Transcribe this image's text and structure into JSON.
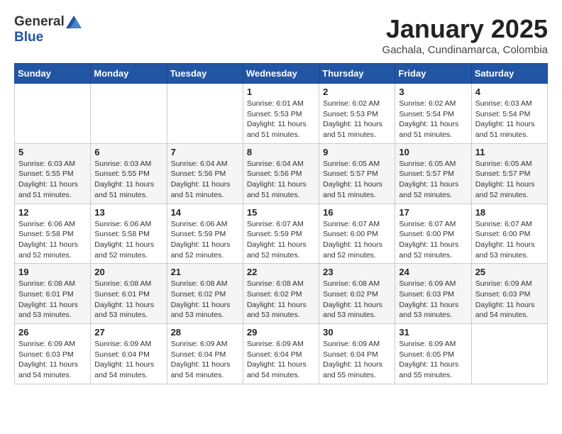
{
  "header": {
    "logo_line1": "General",
    "logo_line2": "Blue",
    "month": "January 2025",
    "location": "Gachala, Cundinamarca, Colombia"
  },
  "weekdays": [
    "Sunday",
    "Monday",
    "Tuesday",
    "Wednesday",
    "Thursday",
    "Friday",
    "Saturday"
  ],
  "weeks": [
    [
      {
        "day": "",
        "info": ""
      },
      {
        "day": "",
        "info": ""
      },
      {
        "day": "",
        "info": ""
      },
      {
        "day": "1",
        "info": "Sunrise: 6:01 AM\nSunset: 5:53 PM\nDaylight: 11 hours\nand 51 minutes."
      },
      {
        "day": "2",
        "info": "Sunrise: 6:02 AM\nSunset: 5:53 PM\nDaylight: 11 hours\nand 51 minutes."
      },
      {
        "day": "3",
        "info": "Sunrise: 6:02 AM\nSunset: 5:54 PM\nDaylight: 11 hours\nand 51 minutes."
      },
      {
        "day": "4",
        "info": "Sunrise: 6:03 AM\nSunset: 5:54 PM\nDaylight: 11 hours\nand 51 minutes."
      }
    ],
    [
      {
        "day": "5",
        "info": "Sunrise: 6:03 AM\nSunset: 5:55 PM\nDaylight: 11 hours\nand 51 minutes."
      },
      {
        "day": "6",
        "info": "Sunrise: 6:03 AM\nSunset: 5:55 PM\nDaylight: 11 hours\nand 51 minutes."
      },
      {
        "day": "7",
        "info": "Sunrise: 6:04 AM\nSunset: 5:56 PM\nDaylight: 11 hours\nand 51 minutes."
      },
      {
        "day": "8",
        "info": "Sunrise: 6:04 AM\nSunset: 5:56 PM\nDaylight: 11 hours\nand 51 minutes."
      },
      {
        "day": "9",
        "info": "Sunrise: 6:05 AM\nSunset: 5:57 PM\nDaylight: 11 hours\nand 51 minutes."
      },
      {
        "day": "10",
        "info": "Sunrise: 6:05 AM\nSunset: 5:57 PM\nDaylight: 11 hours\nand 52 minutes."
      },
      {
        "day": "11",
        "info": "Sunrise: 6:05 AM\nSunset: 5:57 PM\nDaylight: 11 hours\nand 52 minutes."
      }
    ],
    [
      {
        "day": "12",
        "info": "Sunrise: 6:06 AM\nSunset: 5:58 PM\nDaylight: 11 hours\nand 52 minutes."
      },
      {
        "day": "13",
        "info": "Sunrise: 6:06 AM\nSunset: 5:58 PM\nDaylight: 11 hours\nand 52 minutes."
      },
      {
        "day": "14",
        "info": "Sunrise: 6:06 AM\nSunset: 5:59 PM\nDaylight: 11 hours\nand 52 minutes."
      },
      {
        "day": "15",
        "info": "Sunrise: 6:07 AM\nSunset: 5:59 PM\nDaylight: 11 hours\nand 52 minutes."
      },
      {
        "day": "16",
        "info": "Sunrise: 6:07 AM\nSunset: 6:00 PM\nDaylight: 11 hours\nand 52 minutes."
      },
      {
        "day": "17",
        "info": "Sunrise: 6:07 AM\nSunset: 6:00 PM\nDaylight: 11 hours\nand 52 minutes."
      },
      {
        "day": "18",
        "info": "Sunrise: 6:07 AM\nSunset: 6:00 PM\nDaylight: 11 hours\nand 53 minutes."
      }
    ],
    [
      {
        "day": "19",
        "info": "Sunrise: 6:08 AM\nSunset: 6:01 PM\nDaylight: 11 hours\nand 53 minutes."
      },
      {
        "day": "20",
        "info": "Sunrise: 6:08 AM\nSunset: 6:01 PM\nDaylight: 11 hours\nand 53 minutes."
      },
      {
        "day": "21",
        "info": "Sunrise: 6:08 AM\nSunset: 6:02 PM\nDaylight: 11 hours\nand 53 minutes."
      },
      {
        "day": "22",
        "info": "Sunrise: 6:08 AM\nSunset: 6:02 PM\nDaylight: 11 hours\nand 53 minutes."
      },
      {
        "day": "23",
        "info": "Sunrise: 6:08 AM\nSunset: 6:02 PM\nDaylight: 11 hours\nand 53 minutes."
      },
      {
        "day": "24",
        "info": "Sunrise: 6:09 AM\nSunset: 6:03 PM\nDaylight: 11 hours\nand 53 minutes."
      },
      {
        "day": "25",
        "info": "Sunrise: 6:09 AM\nSunset: 6:03 PM\nDaylight: 11 hours\nand 54 minutes."
      }
    ],
    [
      {
        "day": "26",
        "info": "Sunrise: 6:09 AM\nSunset: 6:03 PM\nDaylight: 11 hours\nand 54 minutes."
      },
      {
        "day": "27",
        "info": "Sunrise: 6:09 AM\nSunset: 6:04 PM\nDaylight: 11 hours\nand 54 minutes."
      },
      {
        "day": "28",
        "info": "Sunrise: 6:09 AM\nSunset: 6:04 PM\nDaylight: 11 hours\nand 54 minutes."
      },
      {
        "day": "29",
        "info": "Sunrise: 6:09 AM\nSunset: 6:04 PM\nDaylight: 11 hours\nand 54 minutes."
      },
      {
        "day": "30",
        "info": "Sunrise: 6:09 AM\nSunset: 6:04 PM\nDaylight: 11 hours\nand 55 minutes."
      },
      {
        "day": "31",
        "info": "Sunrise: 6:09 AM\nSunset: 6:05 PM\nDaylight: 11 hours\nand 55 minutes."
      },
      {
        "day": "",
        "info": ""
      }
    ]
  ]
}
